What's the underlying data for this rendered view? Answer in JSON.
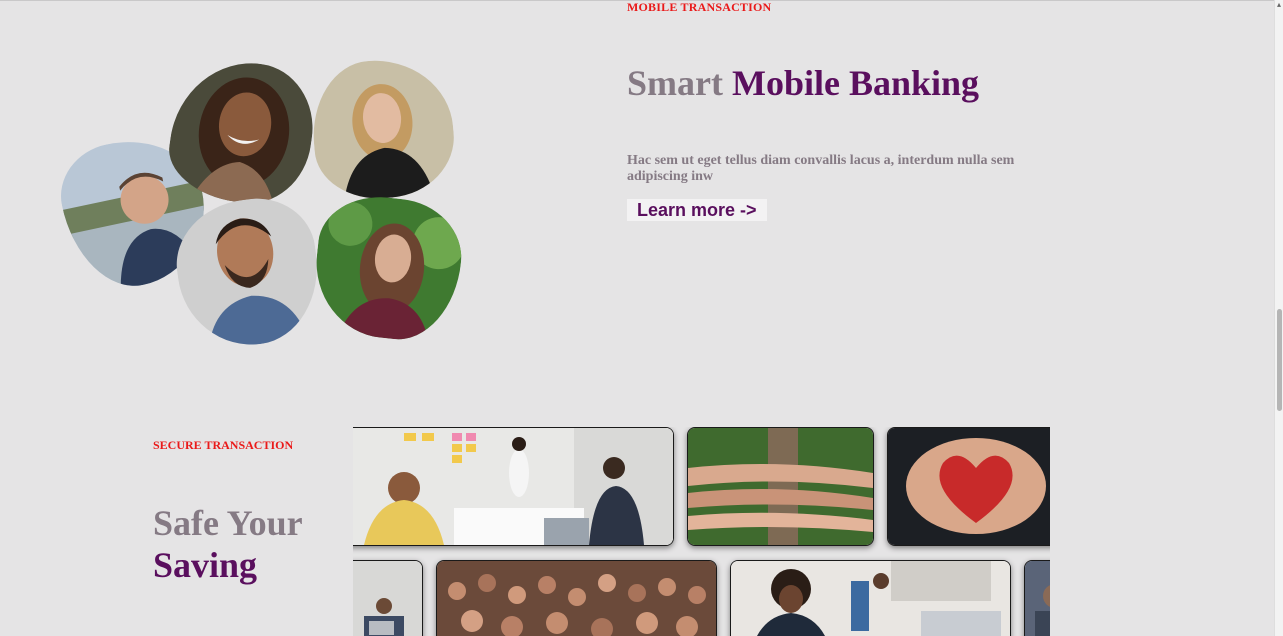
{
  "mobile_section": {
    "eyebrow": "MOBILE TRANSACTION",
    "title_light": "Smart",
    "title_dark": "Mobile Banking",
    "description": "Hac sem ut eget tellus diam convallis lacus a, interdum nulla sem adipiscing inw",
    "cta_label": "Learn more ->",
    "photos": [
      {
        "name": "man-lake-photo"
      },
      {
        "name": "woman-smiling-photo"
      },
      {
        "name": "woman-blonde-photo"
      },
      {
        "name": "man-beard-photo"
      },
      {
        "name": "woman-forest-photo"
      }
    ]
  },
  "secure_section": {
    "eyebrow": "SECURE TRANSACTION",
    "title_light": "Safe Your",
    "title_dark": "Saving",
    "gallery": [
      {
        "name": "office-meeting-photo"
      },
      {
        "name": "hands-on-log-photo"
      },
      {
        "name": "painted-hands-heart-photo"
      },
      {
        "name": "office-workers-photo"
      },
      {
        "name": "crowd-concert-photo"
      },
      {
        "name": "team-laptops-photo"
      },
      {
        "name": "partial-photo"
      }
    ]
  },
  "colors": {
    "background": "#e5e4e5",
    "accent_red": "#ea1a1a",
    "brand_purple": "#5a0f5e",
    "muted_mauve": "#857a84"
  }
}
